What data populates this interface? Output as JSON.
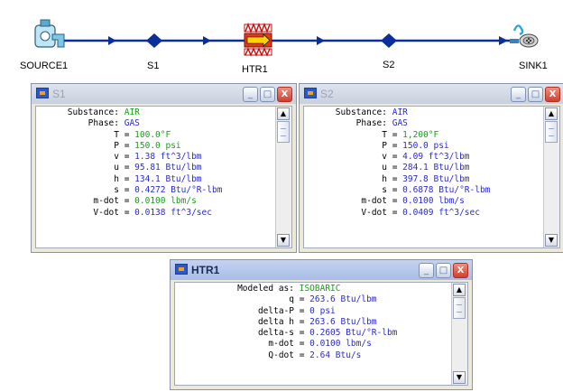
{
  "diagram": {
    "nodes": [
      {
        "label": "SOURCE1",
        "icon": "faucet-icon"
      },
      {
        "label": "S1",
        "icon": "state-point-icon"
      },
      {
        "label": "HTR1",
        "icon": "heater-icon"
      },
      {
        "label": "S2",
        "icon": "state-point-icon"
      },
      {
        "label": "SINK1",
        "icon": "drain-icon"
      }
    ],
    "line_color": "#0a2f9a"
  },
  "windows": [
    {
      "id": "s1",
      "title": "S1",
      "active": false,
      "buttons": {
        "minimize": "_",
        "maximize": "□",
        "close": "X"
      },
      "rows": [
        {
          "label": "Substance:",
          "value": "AIR",
          "color": "green"
        },
        {
          "label": "Phase:",
          "value": "GAS",
          "color": "blue"
        },
        {
          "label": "T",
          "value": "100.0°F",
          "color": "green"
        },
        {
          "label": "P",
          "value": "150.0 psi",
          "color": "green"
        },
        {
          "label": "v",
          "value": "1.38 ft^3/lbm",
          "color": "blue"
        },
        {
          "label": "u",
          "value": "95.81 Btu/lbm",
          "color": "blue"
        },
        {
          "label": "h",
          "value": "134.1 Btu/lbm",
          "color": "blue"
        },
        {
          "label": "s",
          "value": "0.4272 Btu/°R-lbm",
          "color": "blue"
        },
        {
          "label": "m-dot",
          "value": "0.0100 lbm/s",
          "color": "green"
        },
        {
          "label": "V-dot",
          "value": "0.0138 ft^3/sec",
          "color": "blue"
        }
      ]
    },
    {
      "id": "s2",
      "title": "S2",
      "active": false,
      "buttons": {
        "minimize": "_",
        "maximize": "□",
        "close": "X"
      },
      "rows": [
        {
          "label": "Substance:",
          "value": "AIR",
          "color": "blue"
        },
        {
          "label": "Phase:",
          "value": "GAS",
          "color": "blue"
        },
        {
          "label": "T",
          "value": "1,200°F",
          "color": "green"
        },
        {
          "label": "P",
          "value": "150.0 psi",
          "color": "blue"
        },
        {
          "label": "v",
          "value": "4.09 ft^3/lbm",
          "color": "blue"
        },
        {
          "label": "u",
          "value": "284.1 Btu/lbm",
          "color": "blue"
        },
        {
          "label": "h",
          "value": "397.8 Btu/lbm",
          "color": "blue"
        },
        {
          "label": "s",
          "value": "0.6878 Btu/°R-lbm",
          "color": "blue"
        },
        {
          "label": "m-dot",
          "value": "0.0100 lbm/s",
          "color": "blue"
        },
        {
          "label": "V-dot",
          "value": "0.0409 ft^3/sec",
          "color": "blue"
        }
      ]
    },
    {
      "id": "htr1",
      "title": "HTR1",
      "active": true,
      "buttons": {
        "minimize": "_",
        "maximize": "□",
        "close": "X"
      },
      "rows": [
        {
          "label": "Modeled as:",
          "value": "ISOBARIC",
          "color": "green"
        },
        {
          "label": "q",
          "value": "263.6 Btu/lbm",
          "color": "blue"
        },
        {
          "label": "delta-P",
          "value": "0 psi",
          "color": "blue"
        },
        {
          "label": "delta h",
          "value": "263.6 Btu/lbm",
          "color": "blue"
        },
        {
          "label": "delta-s",
          "value": "0.2605 Btu/°R-lbm",
          "color": "blue"
        },
        {
          "label": "m-dot",
          "value": "0.0100 lbm/s",
          "color": "blue"
        },
        {
          "label": "Q-dot",
          "value": "2.64 Btu/s",
          "color": "blue"
        }
      ]
    }
  ]
}
